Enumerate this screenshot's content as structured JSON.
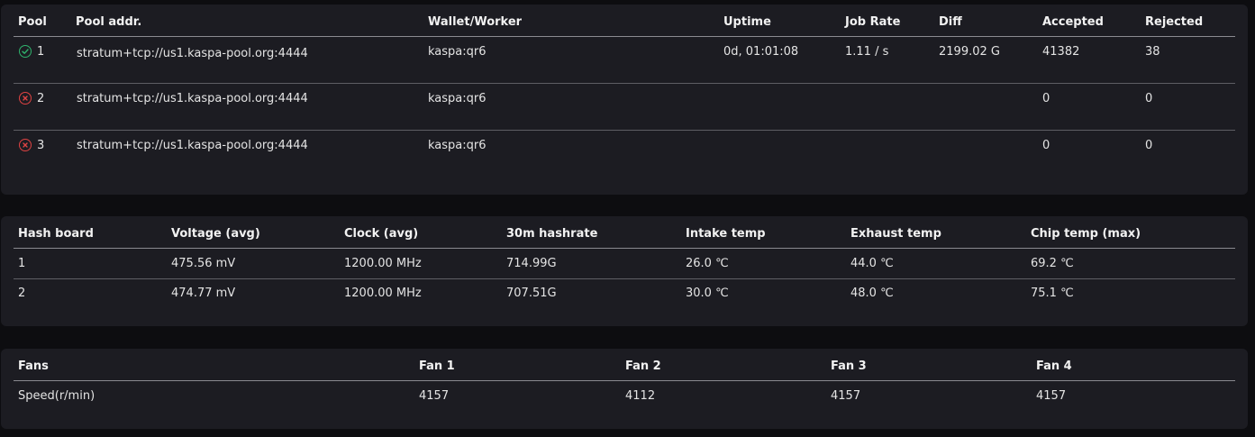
{
  "pools": {
    "headers": [
      "Pool",
      "Pool addr.",
      "Wallet/Worker",
      "Uptime",
      "Job Rate",
      "Diff",
      "Accepted",
      "Rejected"
    ],
    "rows": [
      {
        "status": "check-icon",
        "status_color": "#2fb36d",
        "num": "1",
        "addr": "stratum+tcp://us1.kaspa-pool.org:4444",
        "wallet": "kaspa:qr6",
        "uptime": "0d, 01:01:08",
        "job_rate": "1.11 / s",
        "diff": "2199.02 G",
        "accepted": "41382",
        "rejected": "38"
      },
      {
        "status": "error-icon",
        "status_color": "#e04343",
        "num": "2",
        "addr": "stratum+tcp://us1.kaspa-pool.org:4444",
        "wallet": "kaspa:qr6",
        "uptime": "",
        "job_rate": "",
        "diff": "",
        "accepted": "0",
        "rejected": "0"
      },
      {
        "status": "error-icon",
        "status_color": "#e04343",
        "num": "3",
        "addr": "stratum+tcp://us1.kaspa-pool.org:4444",
        "wallet": "kaspa:qr6",
        "uptime": "",
        "job_rate": "",
        "diff": "",
        "accepted": "0",
        "rejected": "0"
      }
    ]
  },
  "hashboards": {
    "headers": [
      "Hash board",
      "Voltage (avg)",
      "Clock (avg)",
      "30m hashrate",
      "Intake temp",
      "Exhaust temp",
      "Chip temp (max)"
    ],
    "rows": [
      {
        "board": "1",
        "voltage": "475.56 mV",
        "clock": "1200.00 MHz",
        "hashrate": "714.99G",
        "intake": "26.0 ℃",
        "exhaust": "44.0 ℃",
        "chip": "69.2 ℃"
      },
      {
        "board": "2",
        "voltage": "474.77 mV",
        "clock": "1200.00 MHz",
        "hashrate": "707.51G",
        "intake": "30.0 ℃",
        "exhaust": "48.0 ℃",
        "chip": "75.1 ℃"
      }
    ]
  },
  "fans": {
    "headers": [
      "Fans",
      "Fan 1",
      "Fan 2",
      "Fan 3",
      "Fan 4"
    ],
    "row": {
      "label": "Speed(r/min)",
      "values": [
        "4157",
        "4112",
        "4157",
        "4157"
      ]
    }
  }
}
